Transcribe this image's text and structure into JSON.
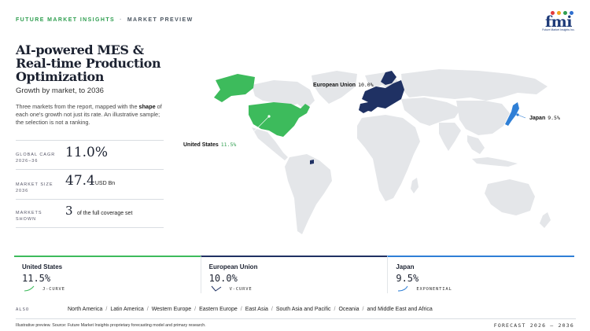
{
  "header": {
    "brand": "FUTURE MARKET INSIGHTS",
    "separator": "·",
    "kicker": "MARKET PREVIEW"
  },
  "logo": {
    "word": "fmi",
    "tagline": "Future Market Insights Inc.",
    "dot_colors": [
      "#e23a3a",
      "#f2a51a",
      "#2e9e4f",
      "#2f6fd0",
      "#7a3fb8"
    ]
  },
  "title": "AI-powered MES & Real-time Production Optimization",
  "subtitle": "Growth by market, to 2036",
  "description": {
    "before": "Three markets from the report, mapped with the ",
    "bold": "shape",
    "after": " of each one's growth not just its rate. An illustrative sample; the selection is not a ranking."
  },
  "stats": {
    "cagr": {
      "label_line1": "GLOBAL CAGR",
      "label_line2": "2026–36",
      "value": "11.0%"
    },
    "size": {
      "label_line1": "MARKET SIZE",
      "label_line2": "2036",
      "value": "47.4",
      "unit": "USD Bn"
    },
    "markets": {
      "label_line1": "MARKETS",
      "label_line2": "SHOWN",
      "value": "3",
      "note": "of the full coverage set"
    }
  },
  "map": {
    "colors": {
      "land": "#e4e6e9",
      "us": "#3dbb5c",
      "eu": "#1f3163",
      "japan": "#2f7fd6"
    },
    "labels": {
      "eu": {
        "name": "European Union",
        "pct": "10.0%"
      },
      "us": {
        "name": "United States",
        "pct": "11.5%"
      },
      "japan": {
        "name": "Japan",
        "pct": "9.5%"
      }
    }
  },
  "cards": [
    {
      "name": "United States",
      "value": "11.5%",
      "type": "J-CURVE",
      "color": "#3dbb5c"
    },
    {
      "name": "European Union",
      "value": "10.0%",
      "type": "V-CURVE",
      "color": "#1f3163"
    },
    {
      "name": "Japan",
      "value": "9.5%",
      "type": "EXPONENTIAL",
      "color": "#2f7fd6"
    }
  ],
  "also": {
    "label": "ALSO",
    "items": [
      "North America",
      "Latin America",
      "Western Europe",
      "Eastern Europe",
      "East Asia",
      "South Asia and Pacific",
      "Oceania",
      "and Middle East and Africa"
    ]
  },
  "footnote": "Illustrative preview. Source: Future Market Insights proprietary forecasting model and primary research.",
  "forecast": "FORECAST 2026 – 2036"
}
